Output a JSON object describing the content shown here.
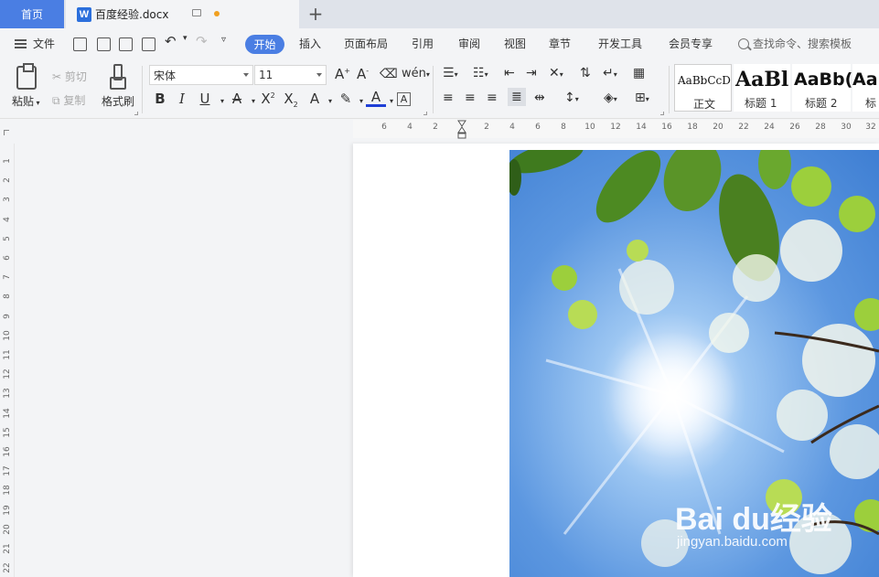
{
  "tabs": {
    "home": "首页",
    "document": "百度经验.docx"
  },
  "menu": {
    "file": "文件",
    "items": [
      "开始",
      "插入",
      "页面布局",
      "引用",
      "审阅",
      "视图",
      "章节",
      "开发工具",
      "会员专享"
    ],
    "active": "开始",
    "search_placeholder": "查找命令、搜索模板"
  },
  "ribbon": {
    "paste": "粘贴",
    "cut": "剪切",
    "copy": "复制",
    "format_painter": "格式刷",
    "font_name": "宋体",
    "font_size": "11",
    "styles": [
      {
        "sample": "AaBbCcD",
        "name": "正文"
      },
      {
        "sample": "AaBl",
        "name": "标题 1"
      },
      {
        "sample": "AaBb(",
        "name": "标题 2"
      },
      {
        "sample": "Aa",
        "name": "标"
      }
    ]
  },
  "ruler": {
    "horizontal": [
      "6",
      "4",
      "2",
      "2",
      "4",
      "6",
      "8",
      "10",
      "12",
      "14",
      "16",
      "18",
      "20",
      "22",
      "24",
      "26",
      "28",
      "30",
      "32"
    ],
    "vertical": [
      "1",
      "2",
      "3",
      "4",
      "5",
      "6",
      "7",
      "8",
      "9",
      "10",
      "11",
      "12",
      "13",
      "14",
      "15",
      "16",
      "17",
      "18",
      "19",
      "20",
      "21",
      "22"
    ]
  },
  "watermark": {
    "brand": "Bai  du经验",
    "url": "jingyan.baidu.com"
  },
  "colors": {
    "accent": "#4a7ee3",
    "sky": "#6aa3e8",
    "leaf": "#8dc63f"
  }
}
